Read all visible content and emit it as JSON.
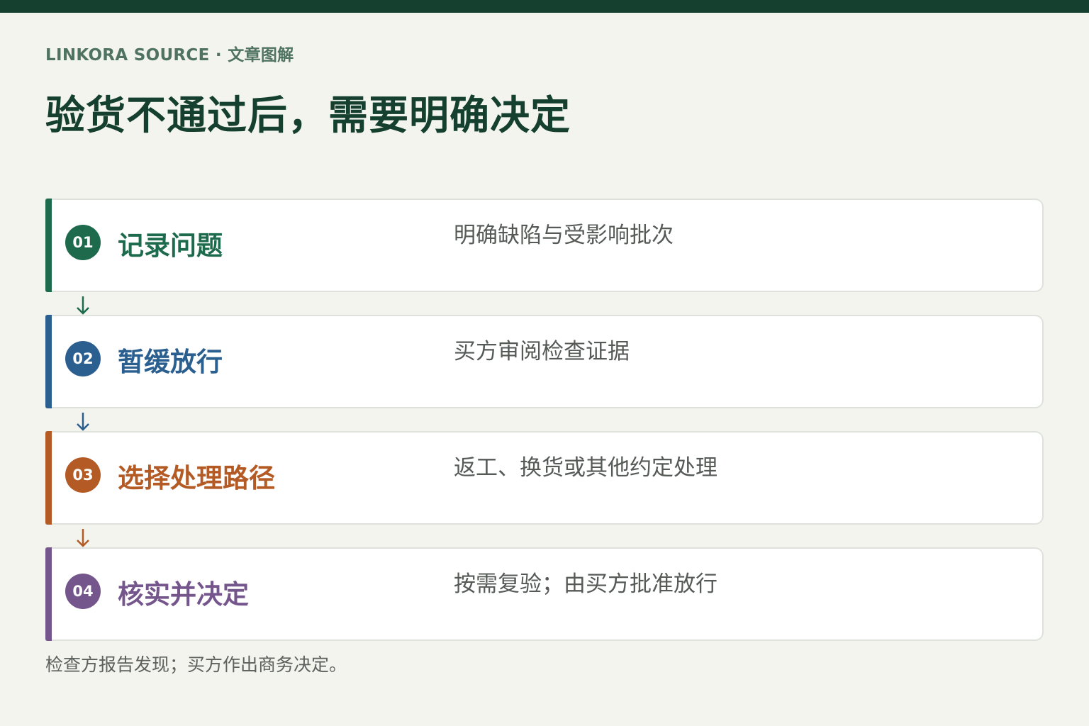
{
  "header": {
    "eyebrow": "LINKORA SOURCE · 文章图解",
    "title": "验货不通过后，需要明确决定"
  },
  "steps": [
    {
      "number": "01",
      "title": "记录问题",
      "description": "明确缺陷与受影响批次",
      "color": "#1d6b4c"
    },
    {
      "number": "02",
      "title": "暂缓放行",
      "description": "买方审阅检查证据",
      "color": "#2b5f8f"
    },
    {
      "number": "03",
      "title": "选择处理路径",
      "description": "返工、换货或其他约定处理",
      "color": "#b35a25"
    },
    {
      "number": "04",
      "title": "核实并决定",
      "description": "按需复验；由买方批准放行",
      "color": "#74558c"
    }
  ],
  "connectors": [
    {
      "icon": "arrow-down-icon",
      "color": "#1d6b4c"
    },
    {
      "icon": "arrow-down-icon",
      "color": "#2b5f8f"
    },
    {
      "icon": "arrow-down-icon",
      "color": "#b35a25"
    }
  ],
  "footnote": "检查方报告发现；买方作出商务决定。"
}
